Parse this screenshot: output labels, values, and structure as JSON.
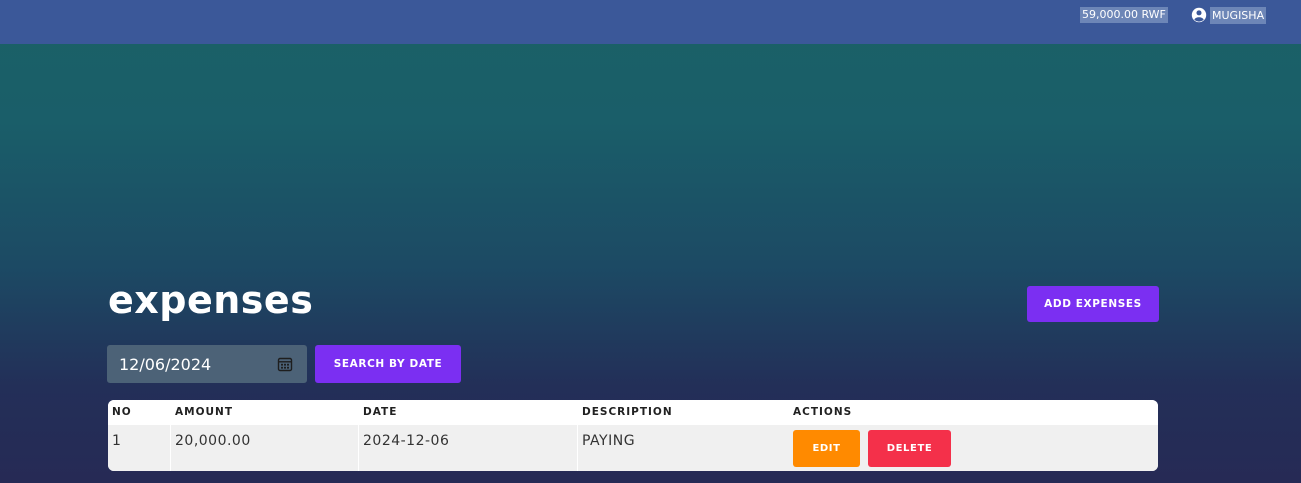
{
  "header": {
    "balance": "59,000.00 RWF",
    "user_name": "MUGISHA",
    "user_icon": "user-circle-icon"
  },
  "page": {
    "title": "expenses",
    "add_button_label": "ADD EXPENSES"
  },
  "filter": {
    "date_value": "12/06/2024",
    "calendar_icon": "calendar-icon",
    "search_button_label": "SEARCH BY DATE"
  },
  "table": {
    "columns": [
      "NO",
      "AMOUNT",
      "DATE",
      "DESCRIPTION",
      "ACTIONS"
    ],
    "rows": [
      {
        "no": "1",
        "amount": "20,000.00",
        "date": "2024-12-06",
        "description": "PAYING",
        "edit_label": "EDIT",
        "delete_label": "DELETE"
      }
    ]
  },
  "colors": {
    "topbar": "#3b5899",
    "primary_button": "#7b2ff2",
    "edit_button": "#ff8a00",
    "delete_button": "#f4304a"
  }
}
